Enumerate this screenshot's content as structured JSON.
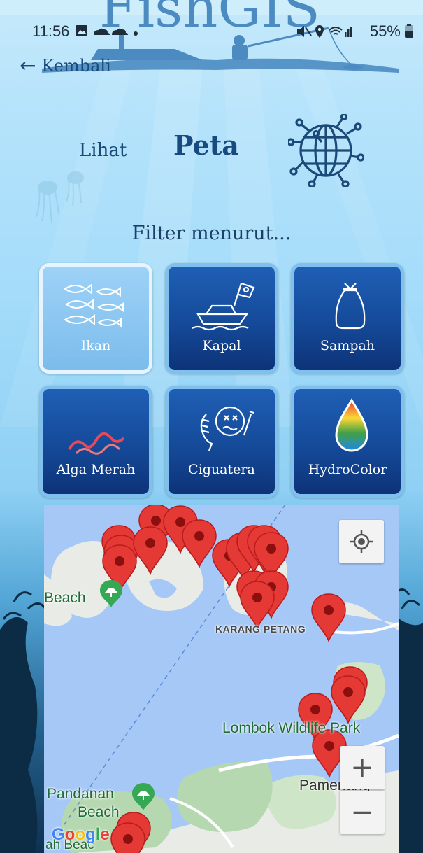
{
  "status_bar": {
    "time": "11:56",
    "battery": "55%"
  },
  "banner": {
    "app_name": "FishGIS"
  },
  "nav": {
    "back_label": "Kembali"
  },
  "header": {
    "prefix": "Lihat",
    "title": "Peta",
    "icon": "globe-network-icon"
  },
  "filter": {
    "heading": "Filter menurut...",
    "options": [
      {
        "label": "Ikan",
        "icon": "fish-icon",
        "selected": true
      },
      {
        "label": "Kapal",
        "icon": "boat-icon",
        "selected": false
      },
      {
        "label": "Sampah",
        "icon": "trash-bag-icon",
        "selected": false
      },
      {
        "label": "Alga Merah",
        "icon": "red-algae-wave-icon",
        "selected": false
      },
      {
        "label": "Ciguatera",
        "icon": "ciguatera-fish-icon",
        "selected": false
      },
      {
        "label": "HydroColor",
        "icon": "water-drop-icon",
        "selected": false
      }
    ]
  },
  "map": {
    "labels": {
      "beach_top": "Beach",
      "karang_petang": "KARANG PETANG",
      "lombok_wildlife_park": "Lombok Wildlife Park",
      "pamenang": "Pamenang",
      "pandanan_beach_1": "Pandanan",
      "pandanan_beach_2": "Beach",
      "bottom_beach": "ah Beac"
    },
    "google_logo": "Google",
    "zoom_in_label": "+",
    "zoom_out_label": "−",
    "colors": {
      "water": "#a6c8f7",
      "land": "#e8ebe6",
      "marker": "#e53935"
    }
  }
}
